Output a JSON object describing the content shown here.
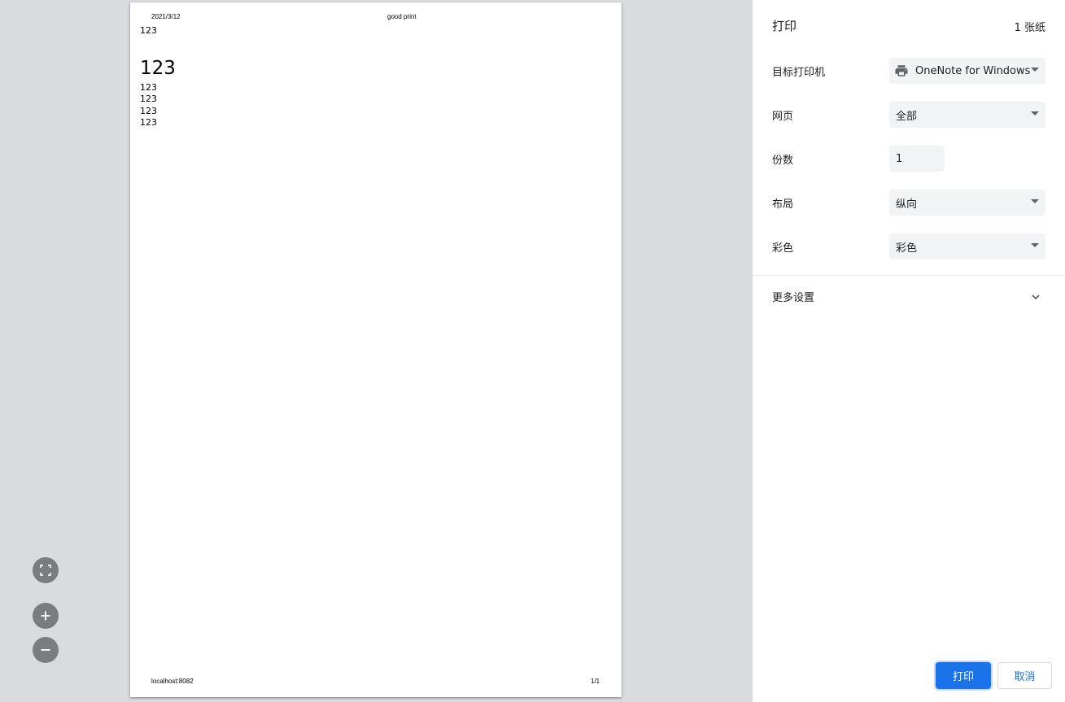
{
  "preview": {
    "header_date": "2021/3/12",
    "header_title": "good print",
    "content": {
      "first_line": "123",
      "large_line": "123",
      "lines": [
        "123",
        "123",
        "123",
        "123"
      ]
    },
    "footer_url": "localhost:8082",
    "footer_page": "1/1"
  },
  "zoom_controls": {
    "fit_icon": "fit-to-page-icon",
    "zoom_in_icon": "plus-icon",
    "zoom_out_icon": "minus-icon"
  },
  "sidebar": {
    "title": "打印",
    "sheet_count": "1 张纸",
    "destination": {
      "label": "目标打印机",
      "value": "OneNote for Windows",
      "icon": "printer-icon"
    },
    "pages": {
      "label": "网页",
      "value": "全部"
    },
    "copies": {
      "label": "份数",
      "value": "1"
    },
    "layout": {
      "label": "布局",
      "value": "纵向"
    },
    "color": {
      "label": "彩色",
      "value": "彩色"
    },
    "more_settings": {
      "label": "更多设置",
      "icon": "chevron-down-icon"
    },
    "print_button": "打印",
    "cancel_button": "取消"
  },
  "colors": {
    "accent": "#1a73e8",
    "preview_bg": "#dadbde",
    "field_bg": "#f1f3f4"
  }
}
